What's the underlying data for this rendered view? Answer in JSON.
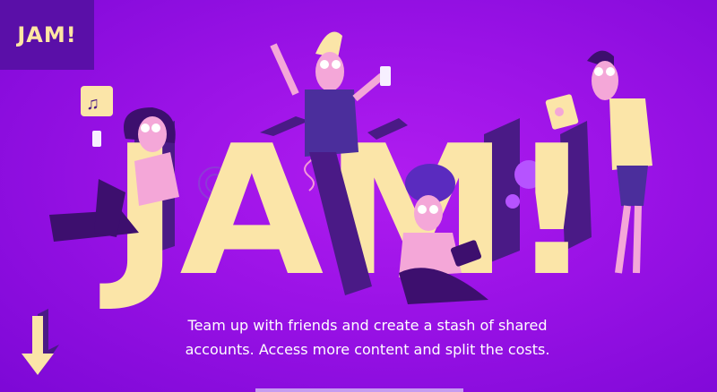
{
  "brand": {
    "logo_label": "JAM!"
  },
  "hero": {
    "title": "JAM!"
  },
  "tagline": {
    "line1": "Team up with friends and create a stash of shared",
    "line2": "accounts. Access more content and split the costs."
  },
  "colors": {
    "background": "#9a12e6",
    "logo_bg": "#5a0fa8",
    "letter_face": "#fbe5a8",
    "letter_side": "#4a1a86",
    "skin": "#f4a7d8"
  },
  "icons": {
    "scroll": "arrow-down-icon",
    "music": "music-note-icon"
  }
}
